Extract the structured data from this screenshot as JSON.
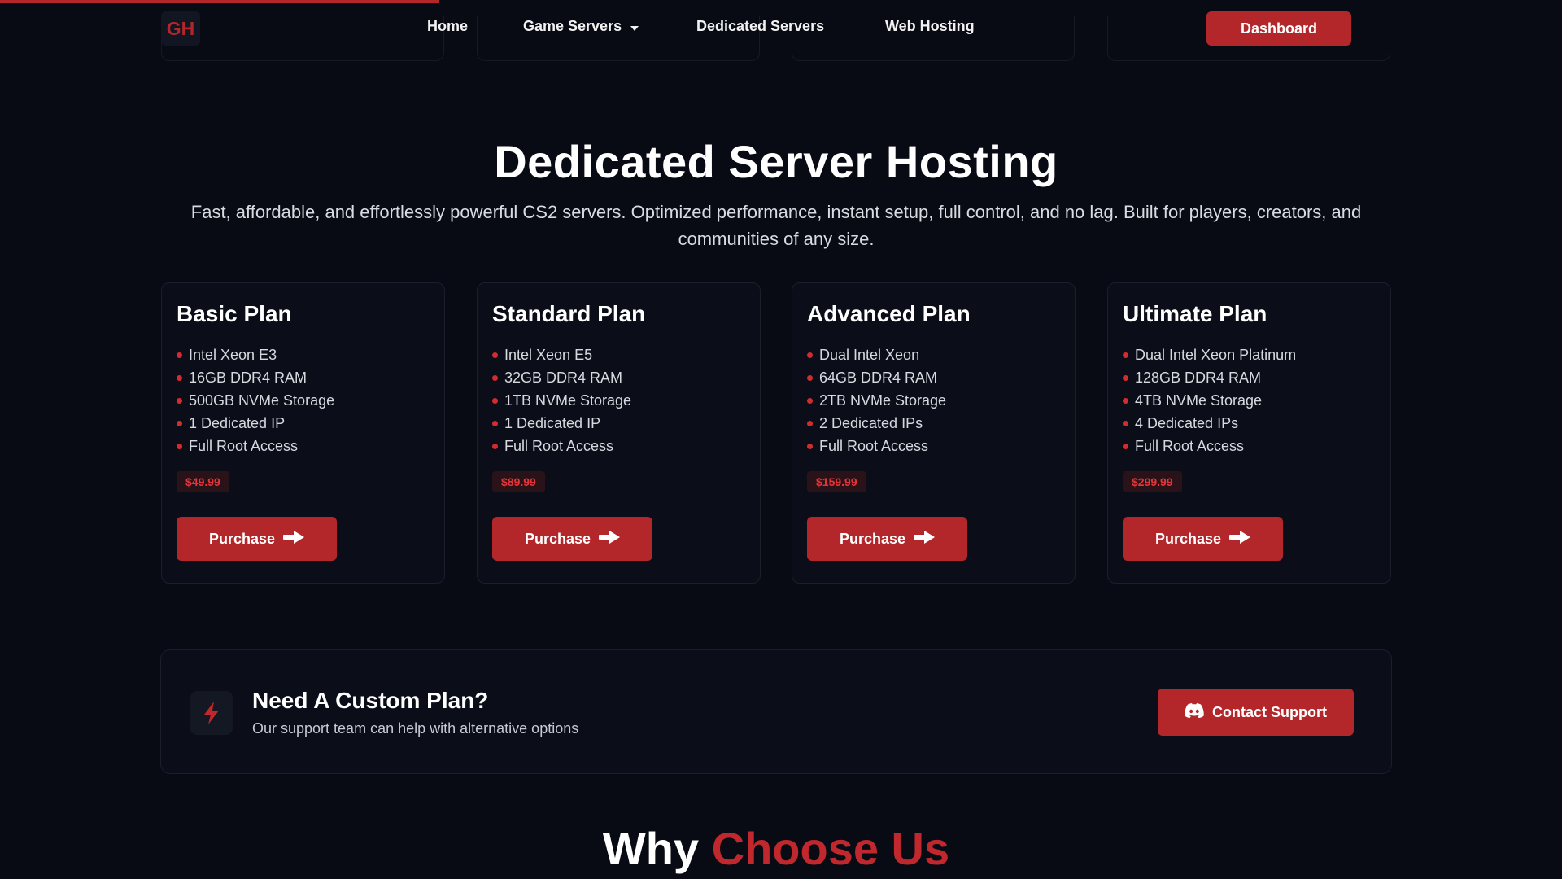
{
  "theme": {
    "accent": "#b3262a",
    "background": "#080b14",
    "card": "#0b0e18",
    "price_text": "#e5353b"
  },
  "navbar": {
    "logo_text": "GH",
    "links": [
      "Home",
      "Game Servers",
      "Dedicated Servers",
      "Web Hosting"
    ],
    "game_servers_icon": "caret-down-icon",
    "dashboard_label": "Dashboard"
  },
  "hero": {
    "title": "Dedicated Server Hosting",
    "subtitle": "Fast, affordable, and effortlessly powerful CS2 servers. Optimized performance, instant setup, full control, and no lag. Built for players, creators, and communities of any size."
  },
  "plans": [
    {
      "name": "Basic Plan",
      "features": [
        "Intel Xeon E3",
        "16GB DDR4 RAM",
        "500GB NVMe Storage",
        "1 Dedicated IP",
        "Full Root Access"
      ],
      "price": "$49.99",
      "button_label": "Purchase"
    },
    {
      "name": "Standard Plan",
      "features": [
        "Intel Xeon E5",
        "32GB DDR4 RAM",
        "1TB NVMe Storage",
        "1 Dedicated IP",
        "Full Root Access"
      ],
      "price": "$89.99",
      "button_label": "Purchase"
    },
    {
      "name": "Advanced Plan",
      "features": [
        "Dual Intel Xeon",
        "64GB DDR4 RAM",
        "2TB NVMe Storage",
        "2 Dedicated IPs",
        "Full Root Access"
      ],
      "price": "$159.99",
      "button_label": "Purchase"
    },
    {
      "name": "Ultimate Plan",
      "features": [
        "Dual Intel Xeon Platinum",
        "128GB DDR4 RAM",
        "4TB NVMe Storage",
        "4 Dedicated IPs",
        "Full Root Access"
      ],
      "price": "$299.99",
      "button_label": "Purchase"
    }
  ],
  "custom_plan": {
    "icon": "lightning-bolt-icon",
    "title": "Need A Custom Plan?",
    "subtitle": "Our support team can help with alternative options",
    "button_icon": "discord-icon",
    "button_label": "Contact Support"
  },
  "why_section": {
    "title_white": "Why ",
    "title_accent": "Choose Us"
  }
}
